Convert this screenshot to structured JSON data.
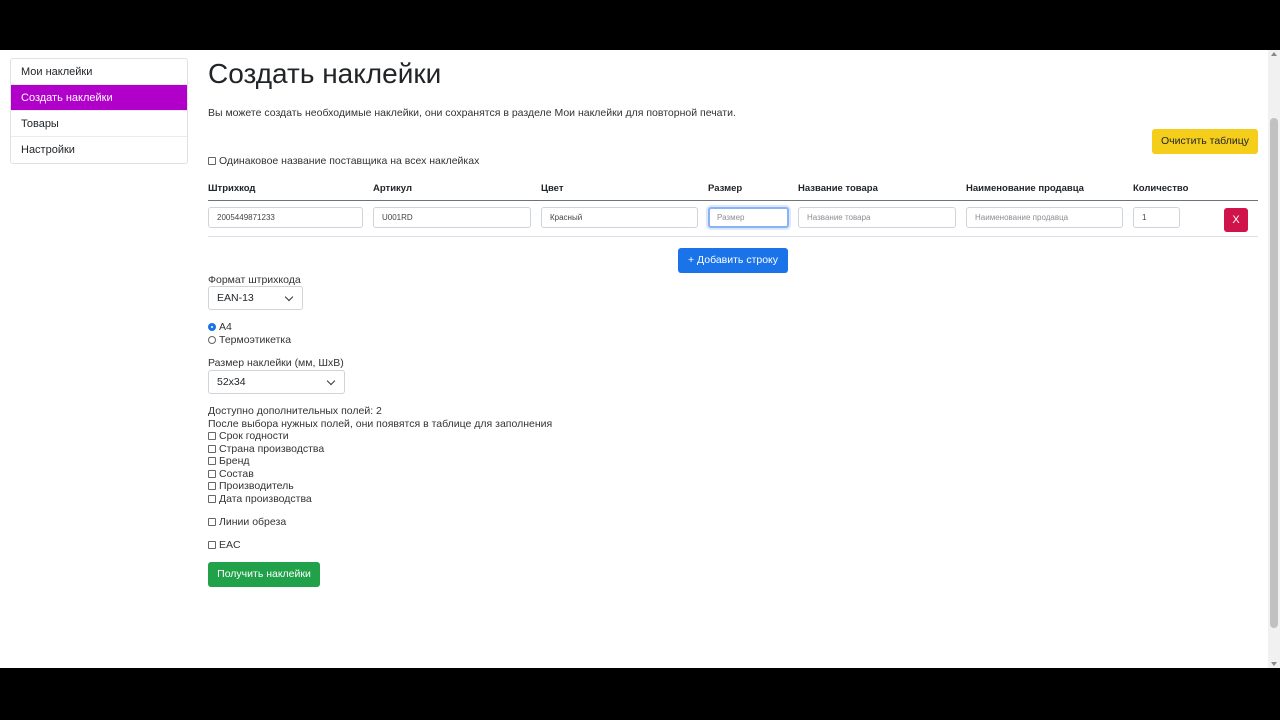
{
  "sidebar": {
    "items": [
      {
        "label": "Мои наклейки"
      },
      {
        "label": "Создать наклейки"
      },
      {
        "label": "Товары"
      },
      {
        "label": "Настройки"
      }
    ]
  },
  "page": {
    "title": "Создать наклейки",
    "lead": "Вы можете создать необходимые наклейки, они сохранятся в разделе Мои наклейки для повторной печати.",
    "clear_button": "Очистить таблицу",
    "same_supplier_label": "Одинаковое название поставщика на всех наклейках"
  },
  "table": {
    "headers": [
      "Штрихкод",
      "Артикул",
      "Цвет",
      "Размер",
      "Название товара",
      "Наименование продавца",
      "Количество"
    ],
    "row": {
      "barcode": "2005449871233",
      "article": "U001RD",
      "color": "Красный",
      "size_placeholder": "Размер",
      "name_placeholder": "Название товара",
      "seller_placeholder": "Наименование продавца",
      "quantity": "1",
      "delete_label": "X"
    },
    "add_row_button": "+ Добавить строку"
  },
  "barcode_format": {
    "label": "Формат штрихкода",
    "selected": "EAN-13"
  },
  "paper": {
    "options": [
      {
        "label": "A4",
        "checked": true
      },
      {
        "label": "Термоэтикетка",
        "checked": false
      }
    ]
  },
  "sticker_size": {
    "label": "Размер наклейки (мм, ШхВ)",
    "selected": "52x34"
  },
  "extra_fields": {
    "available": "Доступно дополнительных полей: 2",
    "hint": "После выбора нужных полей, они появятся в таблице для заполнения",
    "options": [
      "Срок годности",
      "Страна производства",
      "Бренд",
      "Состав",
      "Производитель",
      "Дата производства"
    ]
  },
  "cut_lines_label": "Линии обреза",
  "eac_label": "EAC",
  "submit_button": "Получить наклейки",
  "colors": {
    "active_nav": "#b000c9",
    "clear_button": "#f5cd1b",
    "add_button": "#1a73e8",
    "delete_button": "#d0134a",
    "submit_button": "#20a14a"
  }
}
